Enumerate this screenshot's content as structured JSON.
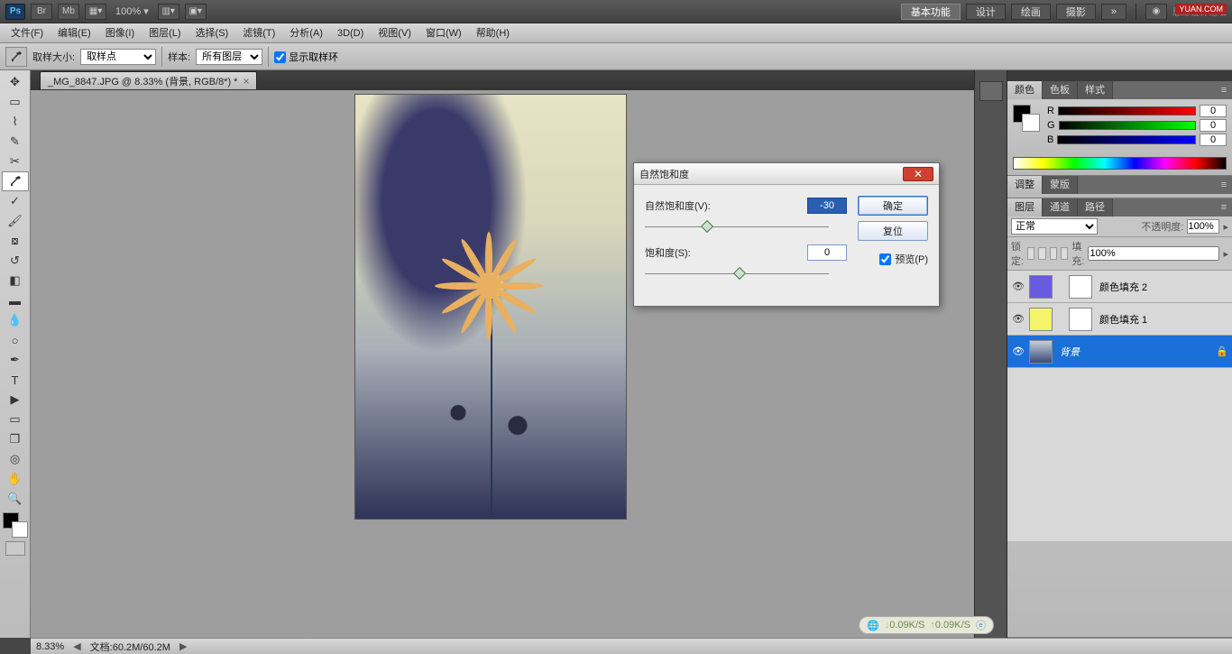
{
  "appbar": {
    "ps": "Ps",
    "zoom": "100% ▾",
    "workspaces": [
      "基本功能",
      "设计",
      "绘画",
      "摄影"
    ],
    "more": "»",
    "logo_text": "思缘设计论坛"
  },
  "watermark": "YUAN.COM",
  "menubar": [
    "文件(F)",
    "编辑(E)",
    "图像(I)",
    "图层(L)",
    "选择(S)",
    "滤镜(T)",
    "分析(A)",
    "3D(D)",
    "视图(V)",
    "窗口(W)",
    "帮助(H)"
  ],
  "optbar": {
    "sample_size_label": "取样大小:",
    "sample_size_value": "取样点",
    "sample_label": "样本:",
    "sample_value": "所有图层",
    "show_ring": "显示取样环"
  },
  "file_tab": {
    "name": "_MG_8847.JPG @ 8.33% (背景, RGB/8*) *"
  },
  "dialog": {
    "title": "自然饱和度",
    "vibrance_label": "自然饱和度(V):",
    "vibrance_value": "-30",
    "saturation_label": "饱和度(S):",
    "saturation_value": "0",
    "ok": "确定",
    "reset": "复位",
    "preview": "预览(P)"
  },
  "panels": {
    "color_tabs": [
      "颜色",
      "色板",
      "样式"
    ],
    "rgb": {
      "r": "0",
      "g": "0",
      "b": "0"
    },
    "adjust_tabs": [
      "调整",
      "蒙版"
    ],
    "layers_tabs": [
      "图层",
      "通道",
      "路径"
    ],
    "blend_mode": "正常",
    "opacity_label": "不透明度:",
    "opacity_value": "100%",
    "lock_label": "锁定:",
    "fill_label": "填充:",
    "fill_value": "100%",
    "layers": [
      {
        "name": "颜色填充 2",
        "thumb": "purple"
      },
      {
        "name": "颜色填充 1",
        "thumb": "yellow"
      },
      {
        "name": "背景",
        "thumb": "img",
        "locked": true,
        "active": true
      }
    ]
  },
  "status": {
    "zoom": "8.33%",
    "doc": "文档:60.2M/60.2M"
  },
  "netstat": {
    "down": "0.09K/S",
    "up": "0.09K/S"
  }
}
